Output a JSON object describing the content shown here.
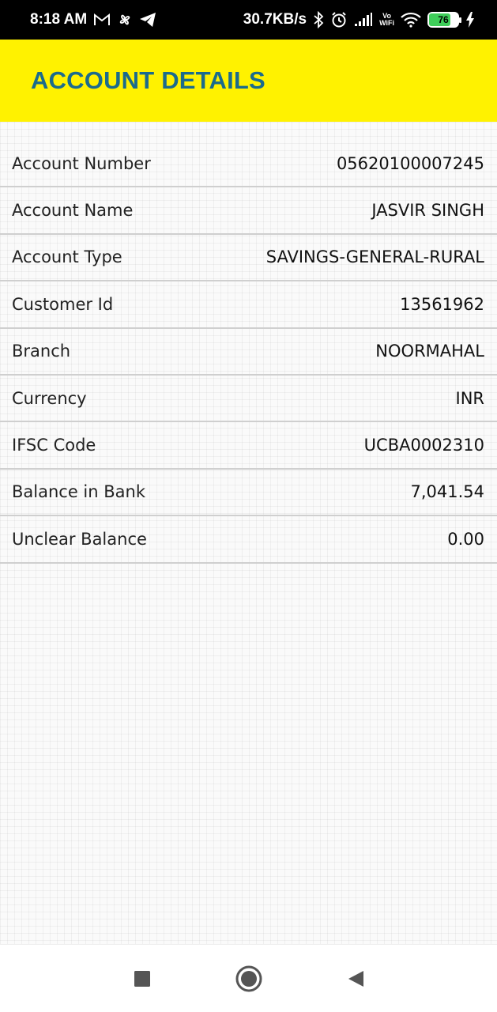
{
  "status_bar": {
    "time": "8:18 AM",
    "network_speed": "30.7KB/s",
    "vowifi_top": "Vo",
    "vowifi_bottom": "WiFi",
    "battery_level": "76",
    "battery_fraction": 0.76,
    "icons": [
      "gmail-icon",
      "pinwheel-icon",
      "telegram-icon",
      "bluetooth-icon",
      "alarm-icon",
      "signal-icon",
      "wifi-icon",
      "charging-icon"
    ]
  },
  "header": {
    "title": "ACCOUNT DETAILS"
  },
  "details": [
    {
      "label": "Account Number",
      "value": "05620100007245"
    },
    {
      "label": "Account Name",
      "value": "JASVIR SINGH"
    },
    {
      "label": "Account Type",
      "value": "SAVINGS-GENERAL-RURAL"
    },
    {
      "label": "Customer Id",
      "value": "13561962"
    },
    {
      "label": "Branch",
      "value": "NOORMAHAL"
    },
    {
      "label": "Currency",
      "value": "INR"
    },
    {
      "label": "IFSC Code",
      "value": "UCBA0002310"
    },
    {
      "label": "Balance in Bank",
      "value": "7,041.54"
    },
    {
      "label": "Unclear Balance",
      "value": "0.00"
    }
  ],
  "nav_bar": {
    "buttons": [
      "recents-button",
      "home-button",
      "back-button"
    ]
  },
  "colors": {
    "app_bar_bg": "#fff200",
    "title_color": "#1b6b8c",
    "battery_green": "#3fce5a"
  }
}
